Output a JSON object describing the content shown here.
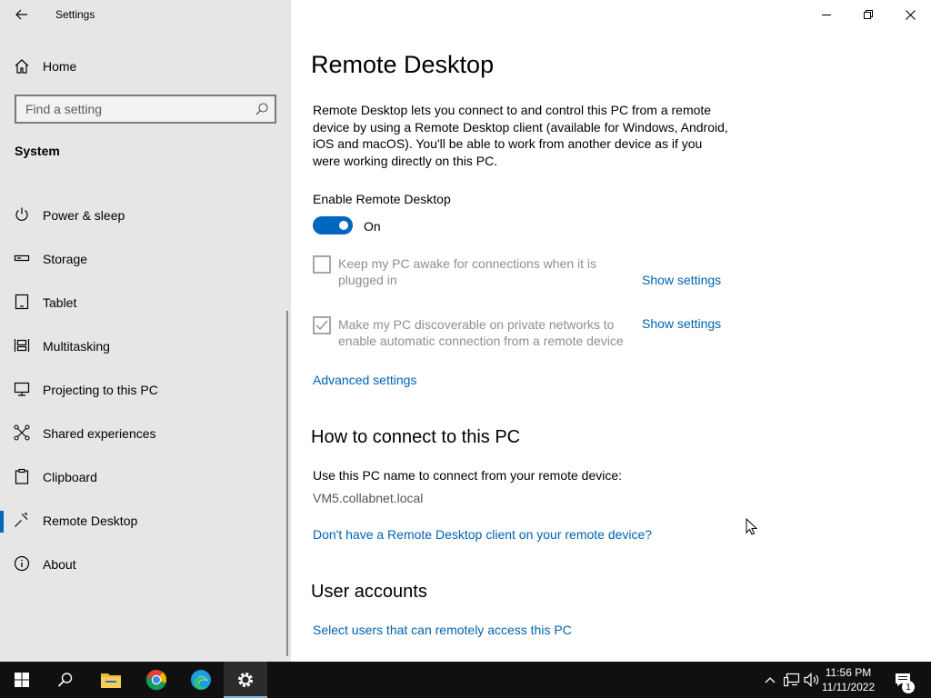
{
  "window": {
    "title": "Settings"
  },
  "sidebar": {
    "home_label": "Home",
    "search_placeholder": "Find a setting",
    "section_title": "System",
    "items": [
      {
        "label": "Power & sleep",
        "icon": "power-icon"
      },
      {
        "label": "Storage",
        "icon": "storage-icon"
      },
      {
        "label": "Tablet",
        "icon": "tablet-icon"
      },
      {
        "label": "Multitasking",
        "icon": "multitasking-icon"
      },
      {
        "label": "Projecting to this PC",
        "icon": "projecting-icon"
      },
      {
        "label": "Shared experiences",
        "icon": "shared-experiences-icon"
      },
      {
        "label": "Clipboard",
        "icon": "clipboard-icon"
      },
      {
        "label": "Remote Desktop",
        "icon": "remote-desktop-icon",
        "selected": true
      },
      {
        "label": "About",
        "icon": "info-icon"
      }
    ]
  },
  "main": {
    "title": "Remote Desktop",
    "description": "Remote Desktop lets you connect to and control this PC from a remote device by using a Remote Desktop client (available for Windows, Android, iOS and macOS). You'll be able to work from another device as if you were working directly on this PC.",
    "enable_label": "Enable Remote Desktop",
    "toggle_state": "On",
    "options": [
      {
        "label": "Keep my PC awake for connections when it is plugged in",
        "checked": false,
        "link": "Show settings"
      },
      {
        "label": "Make my PC discoverable on private networks to enable automatic connection from a remote device",
        "checked": true,
        "link": "Show settings"
      }
    ],
    "advanced_link": "Advanced settings",
    "connect_heading": "How to connect to this PC",
    "connect_text": "Use this PC name to connect from your remote device:",
    "pc_name": "VM5.collabnet.local",
    "client_link": "Don't have a Remote Desktop client on your remote device?",
    "accounts_heading": "User accounts",
    "accounts_link": "Select users that can remotely access this PC"
  },
  "taskbar": {
    "time": "11:56 PM",
    "date": "11/11/2022",
    "notification_count": "1"
  },
  "colors": {
    "accent": "#0067c0",
    "link": "#0063b1",
    "sidebar_bg": "#e6e6e6",
    "taskbar_bg": "#101010"
  }
}
